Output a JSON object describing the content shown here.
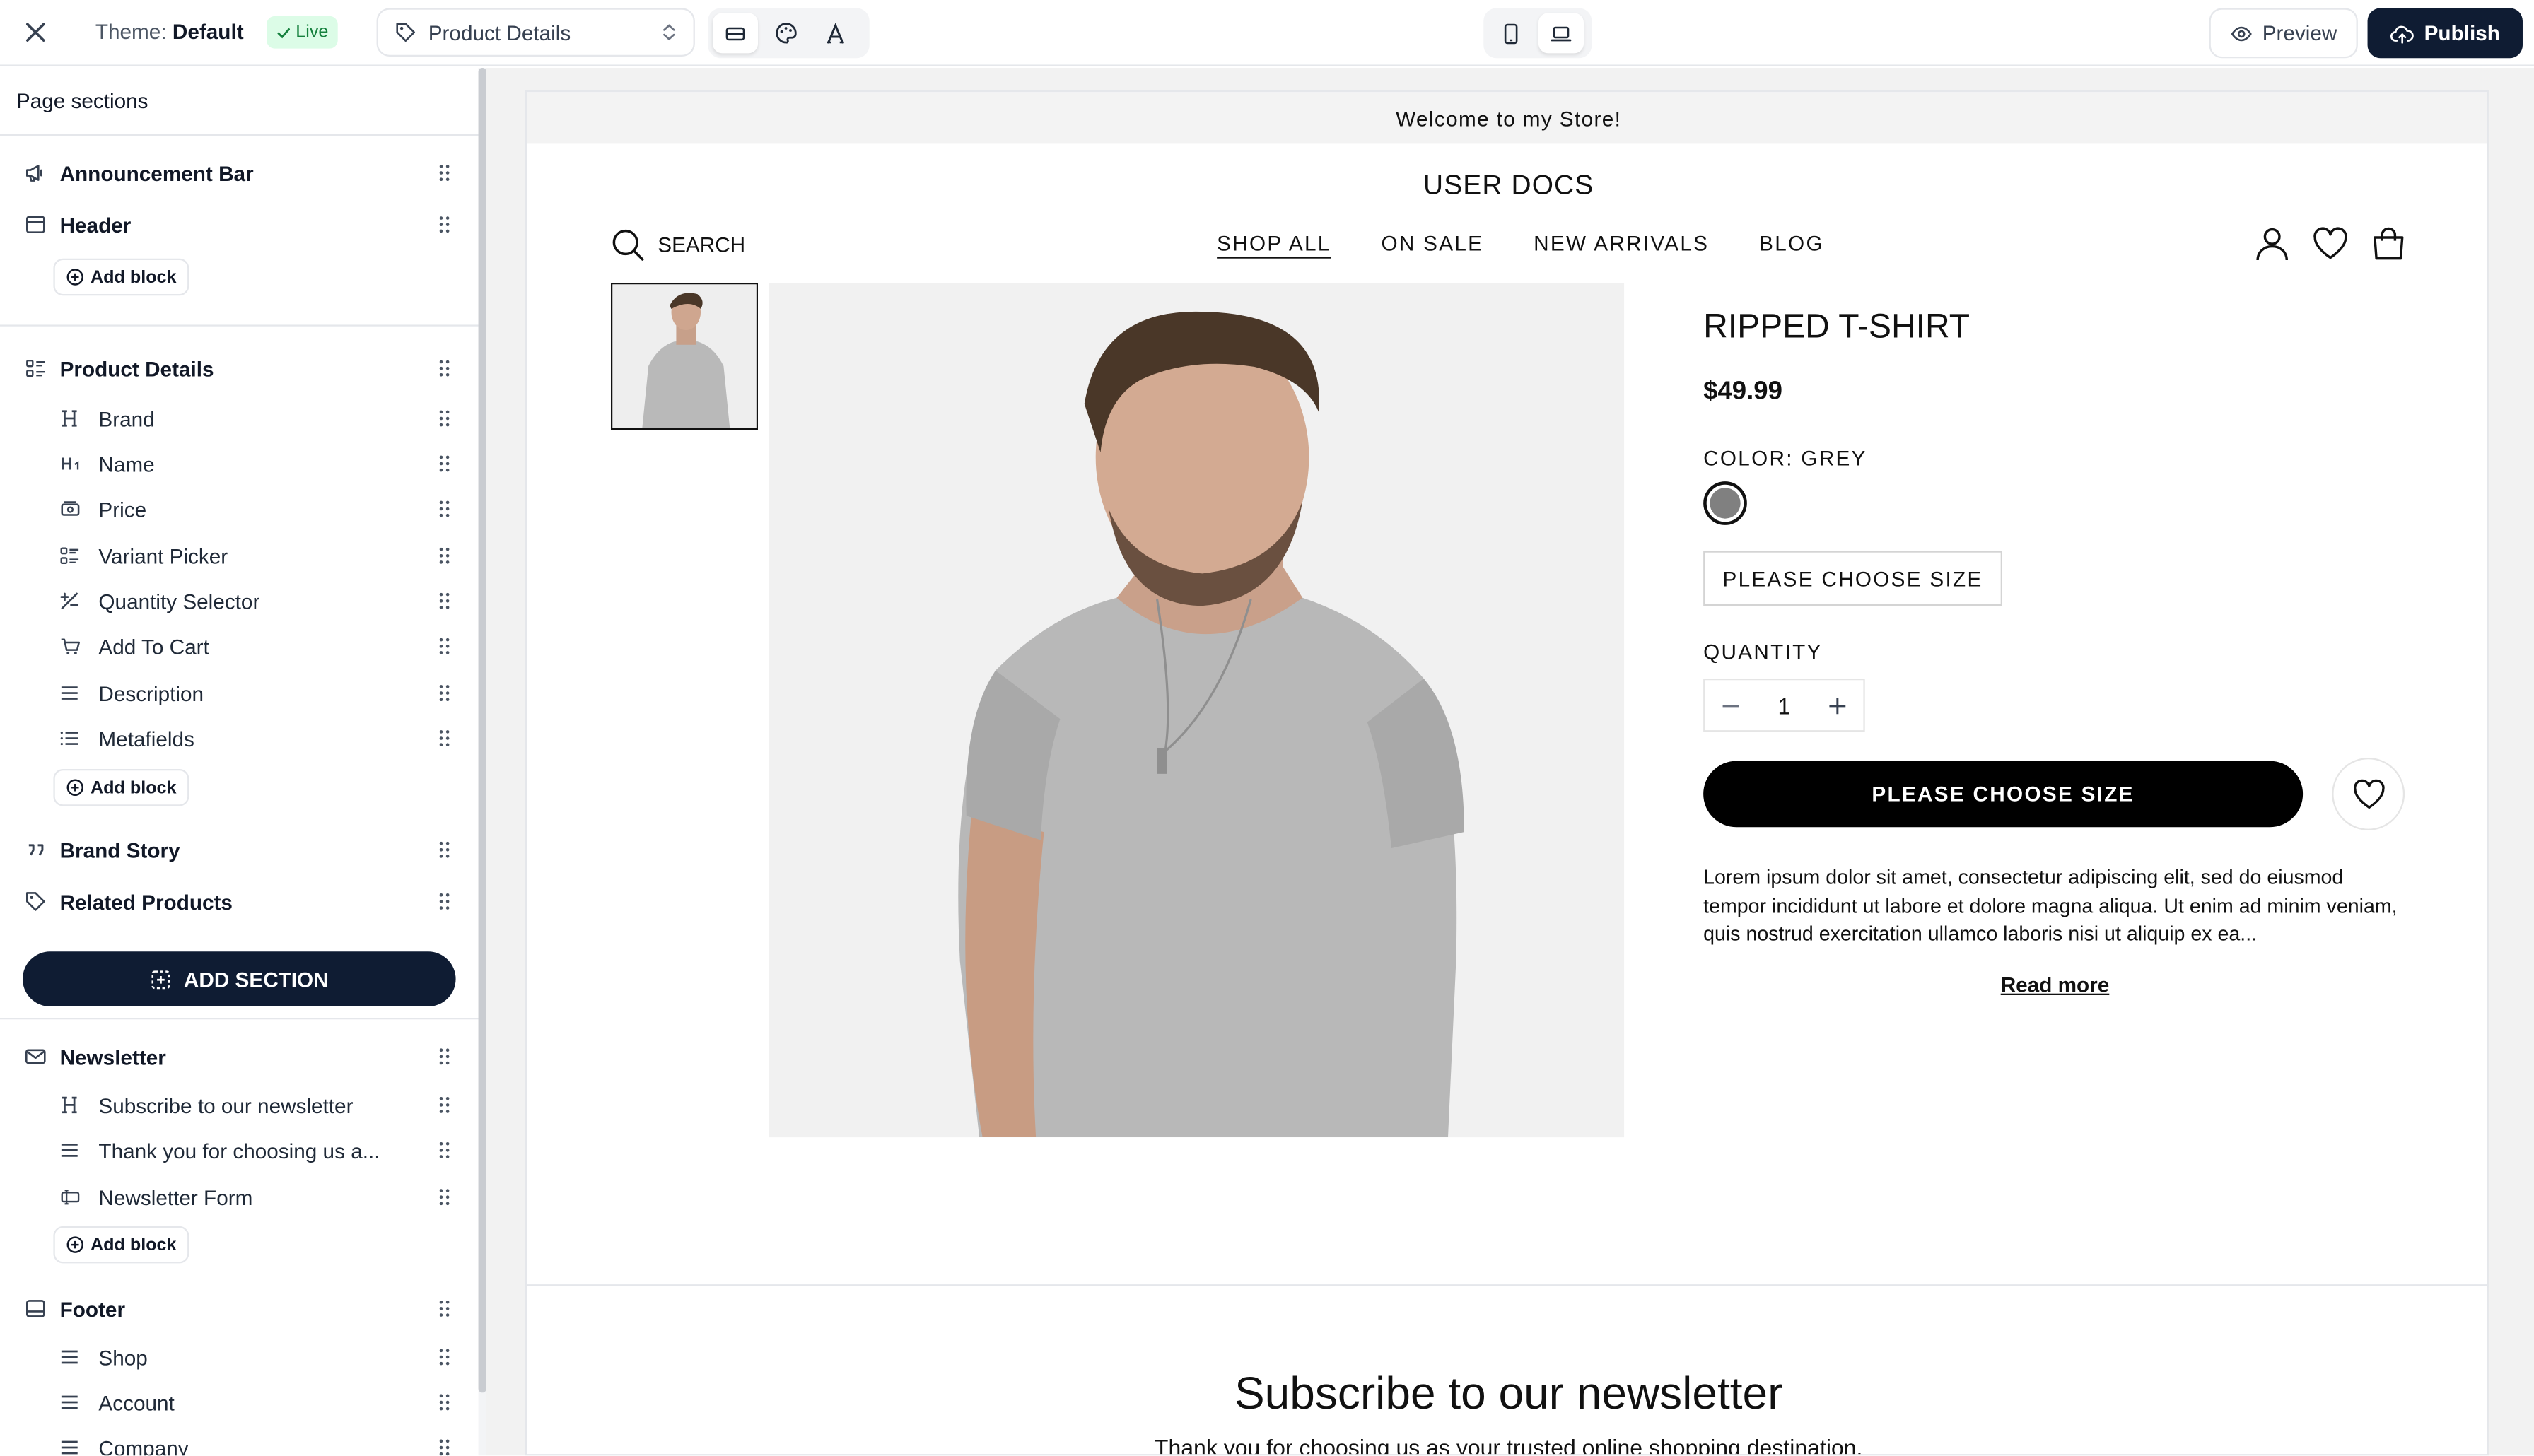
{
  "topbar": {
    "theme_label": "Theme:",
    "theme_name": "Default",
    "live_badge": "Live",
    "template_select": "Product Details",
    "preview_label": "Preview",
    "publish_label": "Publish"
  },
  "sidebar": {
    "title": "Page sections",
    "add_block_label": "Add block",
    "add_section_label": "ADD SECTION",
    "sections": {
      "announcement": {
        "label": "Announcement Bar",
        "icon": "megaphone-icon"
      },
      "header": {
        "label": "Header",
        "icon": "layout-icon"
      },
      "product_details": {
        "label": "Product Details",
        "icon": "list-icon",
        "blocks": [
          {
            "label": "Brand",
            "icon": "heading-icon"
          },
          {
            "label": "Name",
            "icon": "heading-1-icon"
          },
          {
            "label": "Price",
            "icon": "price-tag-icon"
          },
          {
            "label": "Variant Picker",
            "icon": "variant-list-icon"
          },
          {
            "label": "Quantity Selector",
            "icon": "plus-minus-icon"
          },
          {
            "label": "Add To Cart",
            "icon": "cart-icon"
          },
          {
            "label": "Description",
            "icon": "text-lines-icon"
          },
          {
            "label": "Metafields",
            "icon": "list-icon"
          }
        ]
      },
      "brand_story": {
        "label": "Brand Story",
        "icon": "quote-icon"
      },
      "related_products": {
        "label": "Related Products",
        "icon": "tag-icon"
      },
      "newsletter": {
        "label": "Newsletter",
        "icon": "mail-icon",
        "blocks": [
          {
            "label": "Subscribe to our newsletter",
            "icon": "heading-icon"
          },
          {
            "label": "Thank you for choosing us a...",
            "icon": "text-lines-icon"
          },
          {
            "label": "Newsletter Form",
            "icon": "form-icon"
          }
        ]
      },
      "footer": {
        "label": "Footer",
        "icon": "footer-layout-icon",
        "blocks": [
          {
            "label": "Shop",
            "icon": "text-lines-icon"
          },
          {
            "label": "Account",
            "icon": "text-lines-icon"
          },
          {
            "label": "Company",
            "icon": "text-lines-icon"
          }
        ]
      }
    }
  },
  "store": {
    "announcement": "Welcome to my Store!",
    "logo": "USER DOCS",
    "search_label": "SEARCH",
    "nav": [
      "SHOP ALL",
      "ON SALE",
      "NEW ARRIVALS",
      "BLOG"
    ],
    "product": {
      "title": "RIPPED T-SHIRT",
      "price": "$49.99",
      "color_label": "COLOR: GREY",
      "swatch_color": "#808080",
      "size_button": "PLEASE CHOOSE SIZE",
      "quantity_label": "QUANTITY",
      "quantity_value": "1",
      "cart_button": "PLEASE CHOOSE SIZE",
      "description": "Lorem ipsum dolor sit amet, consectetur adipiscing elit, sed do eiusmod tempor incididunt ut labore et dolore magna aliqua. Ut enim ad minim veniam, quis nostrud exercitation ullamco laboris nisi ut aliquip ex ea...",
      "read_more": "Read more"
    },
    "newsletter": {
      "title": "Subscribe to our newsletter",
      "subtitle": "Thank you for choosing us as your trusted online shopping destination."
    }
  },
  "colors": {
    "primary_dark": "#0f1c33",
    "live_green": "#15803d"
  }
}
